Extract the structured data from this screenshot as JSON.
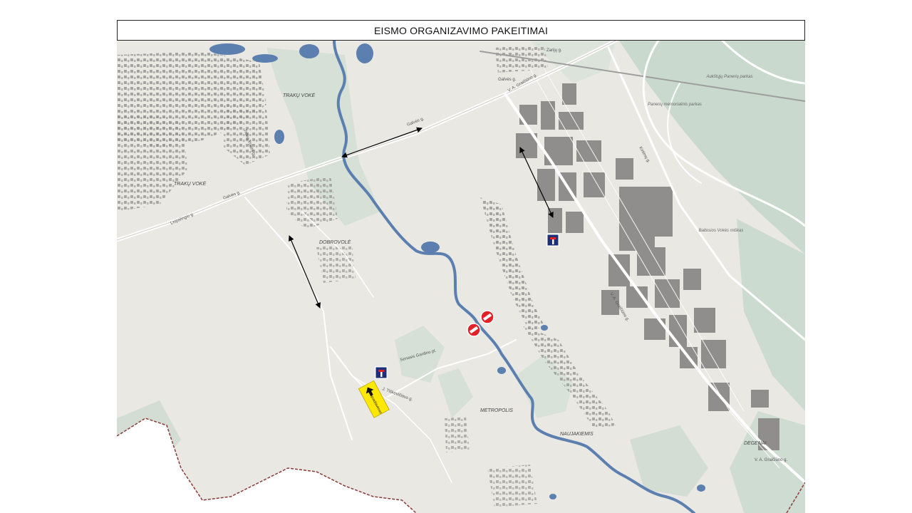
{
  "title": "EISMO ORGANIZAVIMO PAKEITIMAI",
  "map": {
    "area_labels": [
      "TRAKŲ VOKĖ",
      "TRAKŲ VOKĖ",
      "DOBROVOLĖ",
      "METROPOLIS",
      "NAUJAKIEMIS",
      "DEGENAI"
    ],
    "street_labels": [
      "Galvės g.",
      "Galvės g.",
      "Galvės g.",
      "Leipalingio g.",
      "Trakų Vokės g.",
      "V. A. Graičiūno g.",
      "V. A. Graičiūno g.",
      "V. A. Graičiūno g.",
      "Zarijų g.",
      "Kirtimų g.",
      "Senasis Gardino pl.",
      "J. Tiškevičiaus g."
    ],
    "park_labels": [
      "Aukštųjų Panerių parkas",
      "Panerių memorialinis parkas",
      "Baltosios Vokės miškas"
    ],
    "detour_sign_text": "Apvažiavimas",
    "signs": [
      "no-entry-sign",
      "no-entry-sign",
      "dead-end-sign",
      "dead-end-sign",
      "detour-sign"
    ],
    "colors": {
      "river": "#5b7fae",
      "water": "#5b7fae",
      "land": "#eae8e3",
      "green": "#c9d9cd",
      "buildings": "#8c8b89",
      "no_entry_red": "#e32228",
      "dead_end_blue": "#1e2f7a",
      "detour_yellow": "#ffe800",
      "boundary": "#8b3a3a"
    }
  }
}
